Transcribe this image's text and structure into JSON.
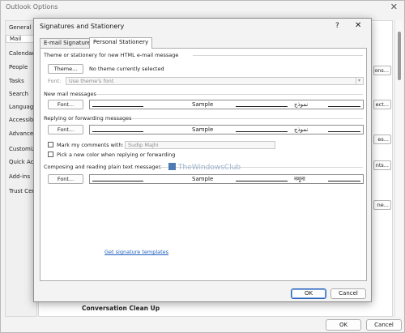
{
  "outer": {
    "title": "Outlook Options",
    "close_glyph": "✕",
    "sidebar": [
      "General",
      "Mail",
      "Calendar",
      "People",
      "Tasks",
      "Search",
      "Language",
      "Accessibi",
      "Advanced",
      "Customiz",
      "Quick Acc",
      "Add-ins",
      "Trust Cent"
    ],
    "peek_buttons": [
      "ons...",
      "ect...",
      "es...",
      "nts...",
      "ne..."
    ],
    "section_heading": "Conversation Clean Up",
    "ok_label": "OK",
    "cancel_label": "Cancel"
  },
  "dialog": {
    "title": "Signatures and Stationery",
    "help_glyph": "?",
    "close_glyph": "✕",
    "tabs": [
      "E-mail Signature",
      "Personal Stationery"
    ],
    "theme_section": {
      "heading": "Theme or stationery for new HTML e-mail message",
      "theme_button": "Theme...",
      "status_text": "No theme currently selected",
      "font_label": "Font:",
      "font_value": "Use theme's font"
    },
    "new_mail": {
      "heading": "New mail messages",
      "font_button": "Font...",
      "sample_left": "Sample",
      "sample_right": "نموذج"
    },
    "reply": {
      "heading": "Replying or forwarding messages",
      "font_button": "Font...",
      "sample_left": "Sample",
      "sample_right": "نموذج",
      "mark_label": "Mark my comments with:",
      "mark_value": "Sudip Majhi",
      "color_label": "Pick a new color when replying or forwarding"
    },
    "plain_text": {
      "heading": "Composing and reading plain text messages",
      "font_button": "Font...",
      "sample_left": "Sample",
      "sample_right": "नमूना"
    },
    "link_text": "Get signature templates",
    "watermark_text": "TheWindowsClub",
    "ok_label": "OK",
    "cancel_label": "Cancel"
  }
}
